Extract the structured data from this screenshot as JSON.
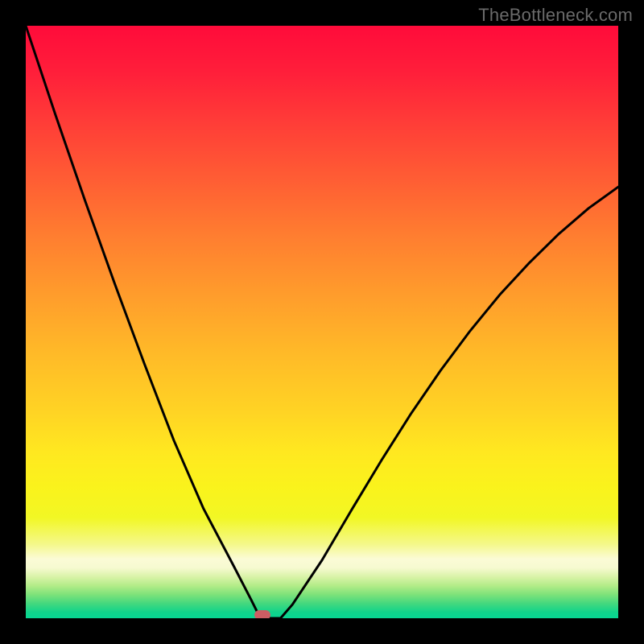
{
  "watermark": "TheBottleneck.com",
  "colors": {
    "frame": "#000000",
    "curve_stroke": "#000000",
    "marker_fill": "#cd5d63",
    "watermark_text": "#6a6a6a"
  },
  "chart_data": {
    "type": "line",
    "title": "",
    "xlabel": "",
    "ylabel": "",
    "xlim": [
      0,
      100
    ],
    "ylim": [
      0,
      100
    ],
    "grid": false,
    "minimum_point": {
      "x": 40,
      "y": 0
    },
    "marker": {
      "x": 40,
      "y": 0
    },
    "series": [
      {
        "name": "left-branch",
        "x": [
          0,
          5,
          10,
          15,
          20,
          25,
          30,
          35,
          38,
          39,
          40
        ],
        "y": [
          100,
          85,
          70.5,
          56.5,
          43,
          30,
          18.5,
          9,
          3.2,
          1.2,
          0
        ]
      },
      {
        "name": "flat-bottom",
        "x": [
          39,
          40,
          41,
          42,
          43
        ],
        "y": [
          0,
          0,
          0,
          0,
          0
        ]
      },
      {
        "name": "right-branch",
        "x": [
          43,
          45,
          50,
          55,
          60,
          65,
          70,
          75,
          80,
          85,
          90,
          95,
          100
        ],
        "y": [
          0,
          2.3,
          9.8,
          18.3,
          26.6,
          34.5,
          41.8,
          48.5,
          54.6,
          60.0,
          64.9,
          69.2,
          72.8
        ]
      }
    ]
  }
}
